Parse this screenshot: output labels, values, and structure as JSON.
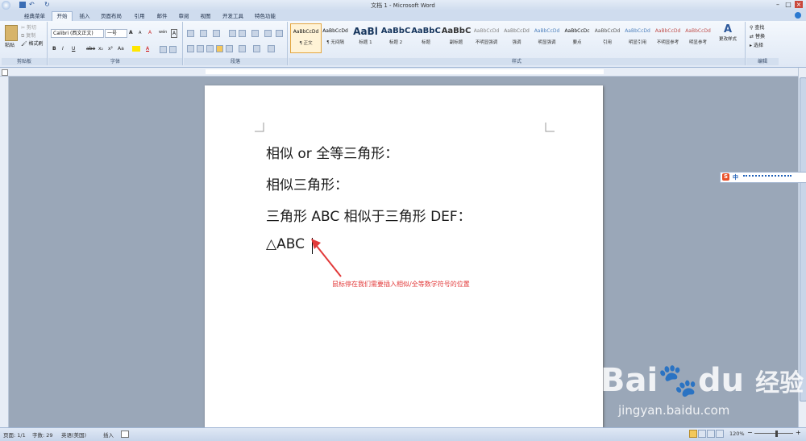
{
  "window": {
    "title": "文档 1 - Microsoft Word"
  },
  "tabs": [
    "经典菜单",
    "开始",
    "插入",
    "页面布局",
    "引用",
    "邮件",
    "审阅",
    "视图",
    "开发工具",
    "特色功能"
  ],
  "clipboard": {
    "paste": "粘贴",
    "cut": "剪切",
    "copy": "复制",
    "format_painter": "格式刷",
    "group": "剪贴板"
  },
  "font": {
    "name": "Calibri (西文正文)",
    "size": "一号",
    "group": "字体",
    "bold": "B",
    "italic": "I",
    "underline": "U",
    "strike": "abe",
    "sub": "x₂",
    "sup": "x²",
    "change_case": "Aa",
    "grow": "A",
    "shrink": "A",
    "clear": "A",
    "phonetic": "wén",
    "border_char": "A"
  },
  "paragraph": {
    "group": "段落"
  },
  "styles": {
    "group": "样式",
    "items": [
      {
        "preview": "AaBbCcDd",
        "name": "¶ 正文"
      },
      {
        "preview": "AaBbCcDd",
        "name": "¶ 无间隔"
      },
      {
        "preview": "AaBl",
        "name": "标题 1"
      },
      {
        "preview": "AaBbC",
        "name": "标题 2"
      },
      {
        "preview": "AaBbC",
        "name": "标题"
      },
      {
        "preview": "AaBbC",
        "name": "副标题"
      },
      {
        "preview": "AaBbCcDd",
        "name": "不明显强调"
      },
      {
        "preview": "AaBbCcDd",
        "name": "强调"
      },
      {
        "preview": "AaBbCcDd",
        "name": "明显强调"
      },
      {
        "preview": "AaBbCcDc",
        "name": "要点"
      },
      {
        "preview": "AaBbCcDd",
        "name": "引用"
      },
      {
        "preview": "AaBbCcDd",
        "name": "明显引用"
      },
      {
        "preview": "AaBbCcDd",
        "name": "不明显参考"
      },
      {
        "preview": "AaBbCcDd",
        "name": "明显参考"
      }
    ],
    "change": "更改样式"
  },
  "editing": {
    "find": "查找",
    "replace": "替换",
    "select": "选择",
    "group": "编辑"
  },
  "document": {
    "lines": [
      "相似  or  全等三角形：",
      "相似三角形：",
      "三角形 ABC 相似于三角形 DEF：",
      "△ABC"
    ]
  },
  "annotation": {
    "text": "鼠标停在我们需要插入相似/全等数学符号的位置",
    "color": "#e23a3a"
  },
  "ime": {
    "lang": "中"
  },
  "status": {
    "page": "页面: 1/1",
    "words": "字数: 29",
    "lang": "英语(美国)",
    "mode": "插入",
    "zoom": "120%"
  },
  "watermark": {
    "brand": "Bai",
    "brand2": "du",
    "cn": "经验",
    "url": "jingyan.baidu.com"
  },
  "colors": {
    "accent": "#2b579a",
    "ribbon": "#dfe8f5"
  }
}
